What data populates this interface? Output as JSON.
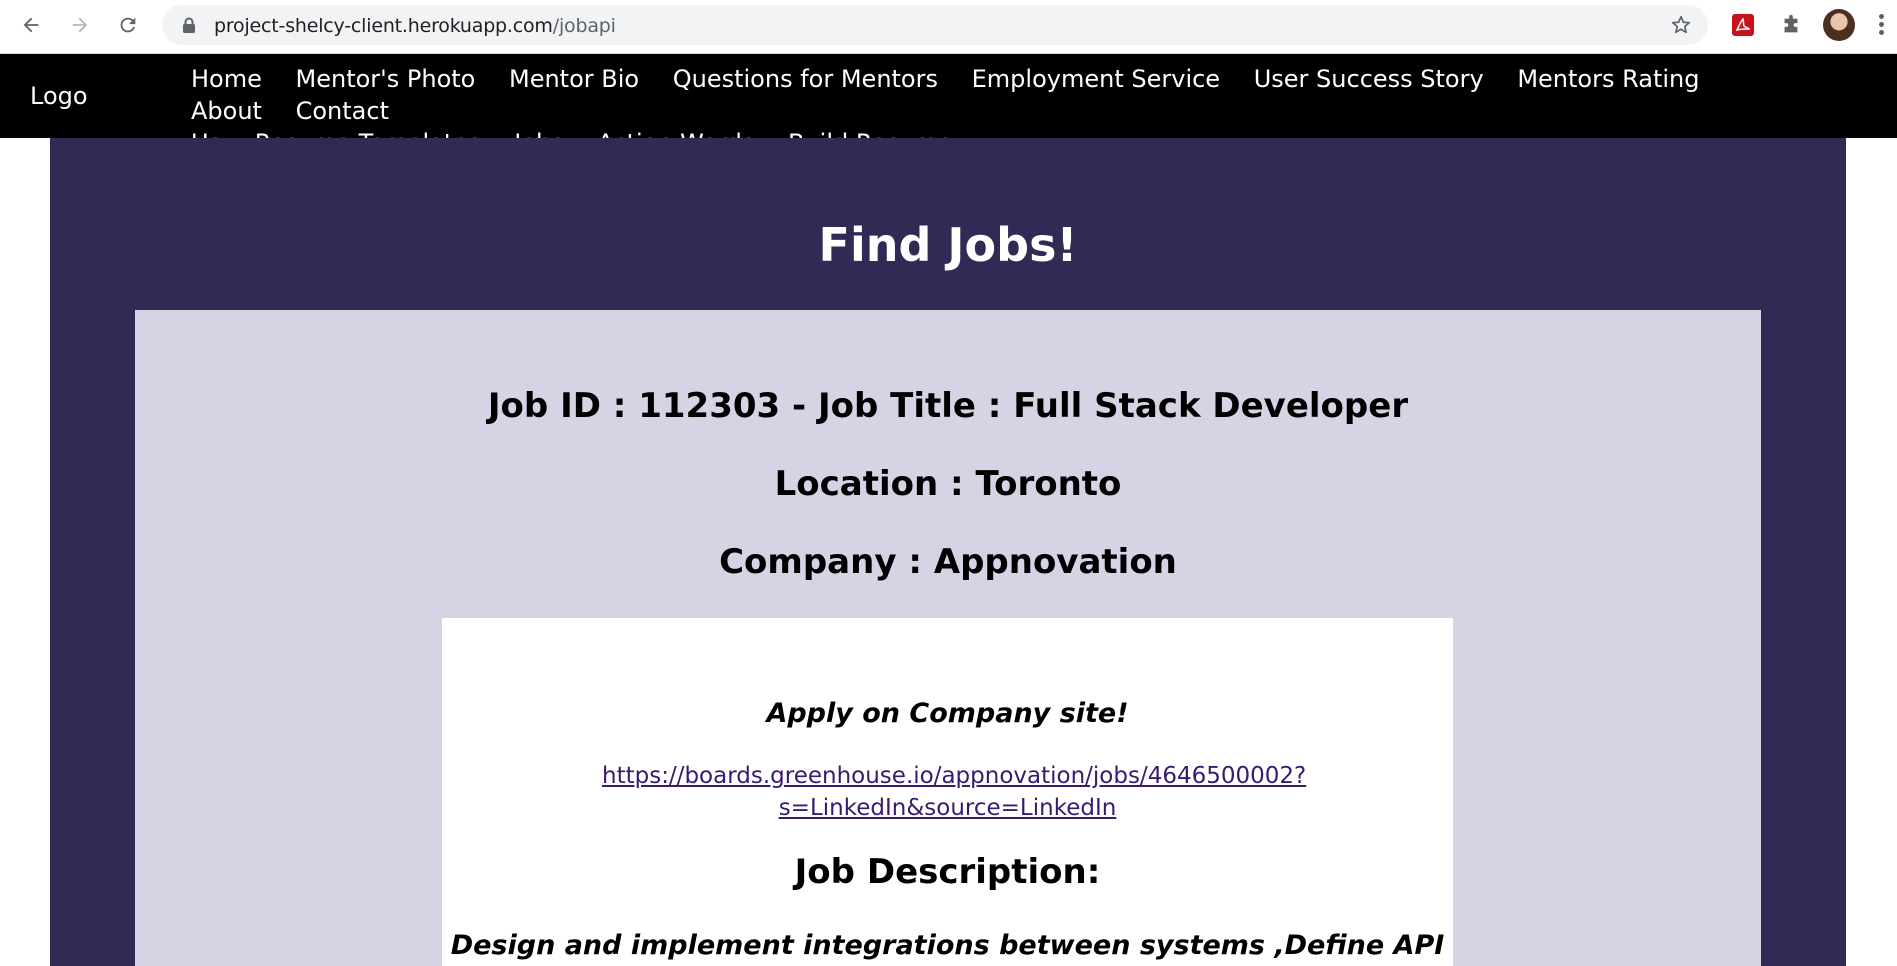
{
  "browser": {
    "url_host": "project-shelcy-client.herokuapp.com",
    "url_path": "/jobapi",
    "icons": [
      "back-arrow-icon",
      "forward-arrow-icon",
      "reload-icon",
      "lock-icon",
      "star-icon",
      "pdf-extension-icon",
      "puzzle-extension-icon",
      "avatar",
      "kebab-menu-icon"
    ]
  },
  "nav": {
    "logo": "Logo",
    "items": [
      "Home",
      "Mentor's Photo",
      "Mentor Bio",
      "Questions for Mentors",
      "Employment Service",
      "User Success Story",
      "Mentors Rating",
      "About",
      "Contact Us",
      "Resume Templates",
      "Jobs",
      "Action Words",
      "Build Resume"
    ],
    "contact_part1": "Contact",
    "contact_part2": "Us"
  },
  "page": {
    "title": "Find Jobs!",
    "job_line": "Job ID : 112303 - Job Title : Full Stack Developer",
    "location_line": "Location : Toronto",
    "company_line": "Company : Appnovation",
    "apply_text": "Apply on Company site!",
    "apply_link_1": "https://boards.greenhouse.io/appnovation/jobs/4646500002?",
    "apply_link_2": "s=LinkedIn&source=LinkedIn",
    "description_heading": "Job Description:",
    "description_text": "Design and implement integrations between systems ,Define API"
  },
  "colors": {
    "nav_bg": "#000000",
    "outer_bg": "#302a54",
    "card_bg": "#d5d3e4",
    "inner_bg": "#ffffff",
    "link": "#3a1a6e"
  }
}
